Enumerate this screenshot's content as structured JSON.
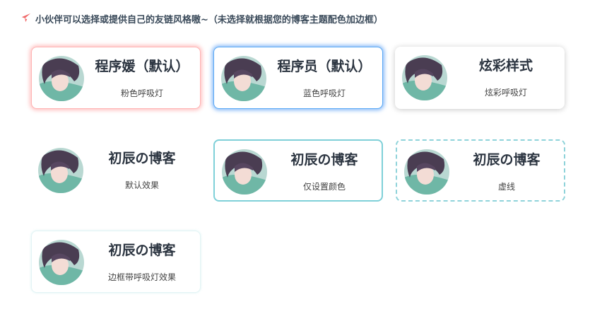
{
  "header": {
    "text": "小伙伴可以选择或提供自己的友链风格嗷~（未选择就根据您的博客主题配色加边框）",
    "icon": "paper-plane-icon",
    "icon_color": "#f06a6a"
  },
  "cards": [
    {
      "title": "程序媛（默认）",
      "subtitle": "粉色呼吸灯",
      "accent": "#ff8a8a"
    },
    {
      "title": "程序员（默认）",
      "subtitle": "蓝色呼吸灯",
      "accent": "#2f8df0"
    },
    {
      "title": "炫彩样式",
      "subtitle": "炫彩呼吸灯",
      "accent": "#888888"
    },
    {
      "title": "初辰の博客",
      "subtitle": "默认效果",
      "accent": "#ffffff"
    },
    {
      "title": "初辰の博客",
      "subtitle": "仅设置颜色",
      "accent": "#7fd0d8"
    },
    {
      "title": "初辰の博客",
      "subtitle": "虚线",
      "accent": "#8fd3da"
    },
    {
      "title": "初辰の博客",
      "subtitle": "边框带呼吸灯效果",
      "accent": "#e3f4f5"
    }
  ]
}
